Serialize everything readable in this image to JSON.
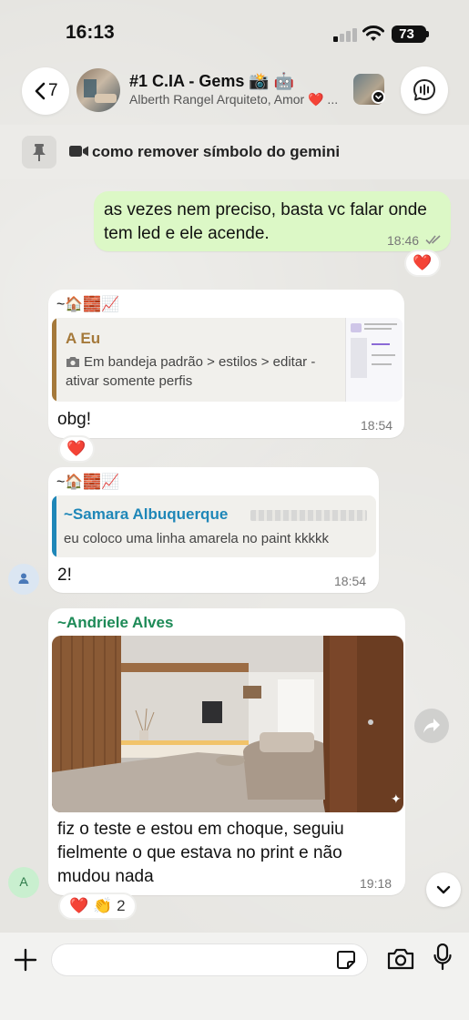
{
  "status_bar": {
    "time": "16:13",
    "battery": "73"
  },
  "header": {
    "back_count": "7",
    "title": "#1 C.IA - Gems 📸 🤖",
    "members": "Alberth Rangel Arquiteto, Amor ❤️ ..."
  },
  "pinned": {
    "text": "como remover símbolo do gemini"
  },
  "messages": {
    "m1": {
      "text": "as vezes nem preciso, basta vc falar onde tem led e ele acende.",
      "time": "18:46",
      "reaction": "❤️"
    },
    "m2": {
      "sender_emojis": "~🏠🧱📈",
      "quote_author": "A Eu",
      "quote_text": "Em bandeja padrão > estilos > editar - ativar somente perfis",
      "text": "obg!",
      "time": "18:54",
      "reaction": "❤️"
    },
    "m3": {
      "sender_emojis": "~🏠🧱📈",
      "quote_author": "~Samara Albuquerque",
      "quote_text": "eu coloco uma linha amarela no paint kkkkk",
      "text": "2!",
      "time": "18:54"
    },
    "m4": {
      "sender": "~Andriele Alves",
      "text": "fiz o teste e estou em choque, seguiu fielmente o que estava no print e não mudou nada",
      "time": "19:18",
      "reactions": "❤️ 👏 2",
      "avatar_letter": "A"
    }
  },
  "composer": {
    "placeholder": ""
  },
  "colors": {
    "outgoing_bubble": "#dcf8c6",
    "quote_eu": "#a5793a",
    "quote_samara": "#1f87b8",
    "sender_andriele": "#1d8a57"
  }
}
